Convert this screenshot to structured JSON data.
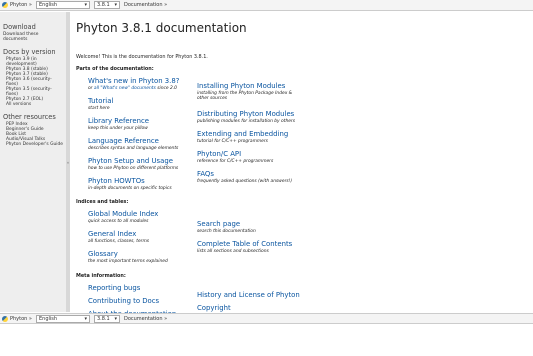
{
  "nav": {
    "crumb_home": "Phyton »",
    "language": "English",
    "version": "3.8.1",
    "crumb_doc": "Documentation »"
  },
  "sidebar": {
    "download_heading": "Download",
    "download_link": "Download these documents",
    "versions_heading": "Docs by version",
    "versions": [
      "Phyton 3.9 (in",
      "development)",
      "Phyton 3.8 (stable)",
      "Phyton 3.7 (stable)",
      "Phyton 3.6 (security-fixes)",
      "Phyton 3.5 (security-fixes)",
      "Phyton 2.7 (EOL)",
      "All versions"
    ],
    "resources_heading": "Other resources",
    "resources": [
      "PEP Index",
      "Beginner's Guide",
      "Book List",
      "Audio/Visual Talks",
      "Phyton Developer's Guide"
    ],
    "collapse_glyph": "«"
  },
  "main": {
    "title": "Phyton 3.8.1 documentation",
    "welcome": "Welcome! This is the documentation for Phyton 3.8.1.",
    "parts_heading": "Parts of the documentation:",
    "parts_left": [
      {
        "title": "What's new in Phyton 3.8?",
        "desc_pre": "or ",
        "desc_link": "all \"What's new\" documents",
        "desc_post": " since 2.0"
      },
      {
        "title": "Tutorial",
        "desc": "start here"
      },
      {
        "title": "Library Reference",
        "desc": "keep this under your pillow"
      },
      {
        "title": "Language Reference",
        "desc": "describes syntax and language elements"
      },
      {
        "title": "Phyton Setup and Usage",
        "desc": "how to use Phyton on different platforms"
      },
      {
        "title": "Phyton HOWTOs",
        "desc": "in-depth documents on specific topics"
      }
    ],
    "parts_right": [
      {
        "title": "Installing Phyton Modules",
        "desc": "installing from the Phyton Package Index &",
        "desc2": "other sources"
      },
      {
        "title": "Distributing Phyton Modules",
        "desc": "publishing modules for installation by others"
      },
      {
        "title": "Extending and Embedding",
        "desc": "tutorial for C/C++ programmers"
      },
      {
        "title": "Phyton/C API",
        "desc": "reference for C/C++ programmers"
      },
      {
        "title": "FAQs",
        "desc": "frequently asked questions (with answers!)"
      }
    ],
    "indices_heading": "Indices and tables:",
    "indices_left": [
      {
        "title": "Global Module Index",
        "desc": "quick access to all modules"
      },
      {
        "title": "General Index",
        "desc": "all functions, classes, terms"
      },
      {
        "title": "Glossary",
        "desc": "the most important terms explained"
      }
    ],
    "indices_right": [
      {
        "title": "Search page",
        "desc": "search this documentation"
      },
      {
        "title": "Complete Table of Contents",
        "desc": "lists all sections and subsections"
      }
    ],
    "meta_heading": "Meta information:",
    "meta_left": [
      "Reporting bugs",
      "Contributing to Docs",
      "About the documentation"
    ],
    "meta_right": [
      "History and License of Phyton",
      "Copyright"
    ]
  }
}
